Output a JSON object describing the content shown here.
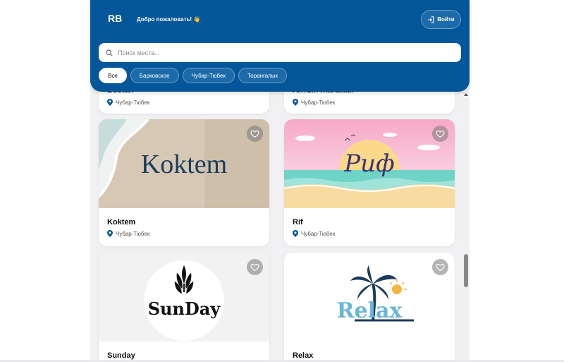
{
  "header": {
    "logo_text": "RB",
    "welcome": "Добро пожаловать! 👋",
    "login_label": "Войти",
    "search_placeholder": "Поиск места...",
    "filters": [
      "Все",
      "Барковское",
      "Чубар-Тюбек",
      "Торангалык"
    ],
    "active_filter": "Все"
  },
  "cards_top_partial": [
    {
      "name": "Bostan",
      "location": "Чубар-Тюбек"
    },
    {
      "name": "Алтын Жагажай",
      "location": "Чубар-Тюбек"
    }
  ],
  "cards": [
    {
      "name": "Koktem",
      "location": "Чубар-Тюбек",
      "image_text": "Koktem"
    },
    {
      "name": "Rif",
      "location": "Чубар-Тюбек",
      "image_text": "Риф"
    },
    {
      "name": "Sunday",
      "location": "",
      "image_text": "SunDay"
    },
    {
      "name": "Relax",
      "location": "",
      "image_text": "Relax"
    }
  ],
  "colors": {
    "header_bg": "#04569a",
    "page_bg": "#f1f1f3",
    "pin": "#04569a"
  },
  "icons": [
    "logo-icon",
    "login-icon",
    "search-icon",
    "heart-icon",
    "pin-icon"
  ]
}
